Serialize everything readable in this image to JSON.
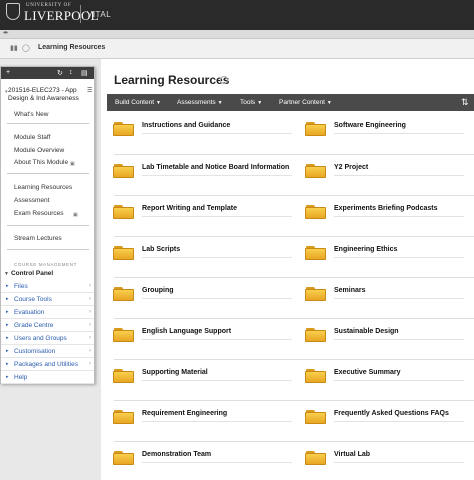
{
  "header": {
    "university_small": "UNIVERSITY OF",
    "university_name": "LIVERPOOL",
    "system_name": "VITAL",
    "crest_icon": "crest-logo-icon"
  },
  "breadcrumb": {
    "title": "Learning Resources",
    "menu_icon": "menu-toggle-icon",
    "refresh_icon": "refresh-icon"
  },
  "sidebar": {
    "tools": {
      "add_icon": "plus-icon",
      "refresh_icon": "refresh-icon",
      "move_icon": "move-icon",
      "collapse_icon": "panel-collapse-icon"
    },
    "course_title": "201516-ELEC273 - App Design & Ind Awareness",
    "course_control_icon": "course-settings-icon",
    "links": [
      {
        "label": "What's New"
      },
      {
        "label": "Module Staff"
      },
      {
        "label": "Module Overview"
      },
      {
        "label": "About This Module",
        "icon": "external-link-icon"
      },
      {
        "label": "Learning Resources"
      },
      {
        "label": "Assessment"
      },
      {
        "label": "Exam Resources",
        "icon": "external-link-icon"
      },
      {
        "label": "Stream Lectures"
      }
    ],
    "management_heading": "COURSE MANAGEMENT",
    "control_panel": {
      "label": "Control Panel",
      "items": [
        {
          "label": "Files"
        },
        {
          "label": "Course Tools"
        },
        {
          "label": "Evaluation"
        },
        {
          "label": "Grade Centre"
        },
        {
          "label": "Users and Groups"
        },
        {
          "label": "Customisation"
        },
        {
          "label": "Packages and Utilities"
        },
        {
          "label": "Help"
        }
      ]
    }
  },
  "content": {
    "title": "Learning Resources",
    "title_icon": "refresh-icon",
    "action_bar": [
      {
        "label": "Build Content"
      },
      {
        "label": "Assessments"
      },
      {
        "label": "Tools"
      },
      {
        "label": "Partner Content"
      }
    ],
    "sort_icon": "sort-icon",
    "folder_icon": "folder-icon",
    "items_left": [
      "Instructions and Guidance",
      "Lab Timetable and Notice Board Information",
      "Report Writing and Template",
      "Lab Scripts",
      "Grouping",
      "English Language Support",
      "Supporting Material",
      "Requirement Engineering",
      "Demonstration Team"
    ],
    "items_right": [
      "Software Engineering",
      "Y2 Project",
      "Experiments Briefing Podcasts",
      "Engineering Ethics",
      "Seminars",
      "Sustainable Design",
      "Executive Summary",
      "Frequently Asked Questions FAQs",
      "Virtual Lab"
    ]
  }
}
